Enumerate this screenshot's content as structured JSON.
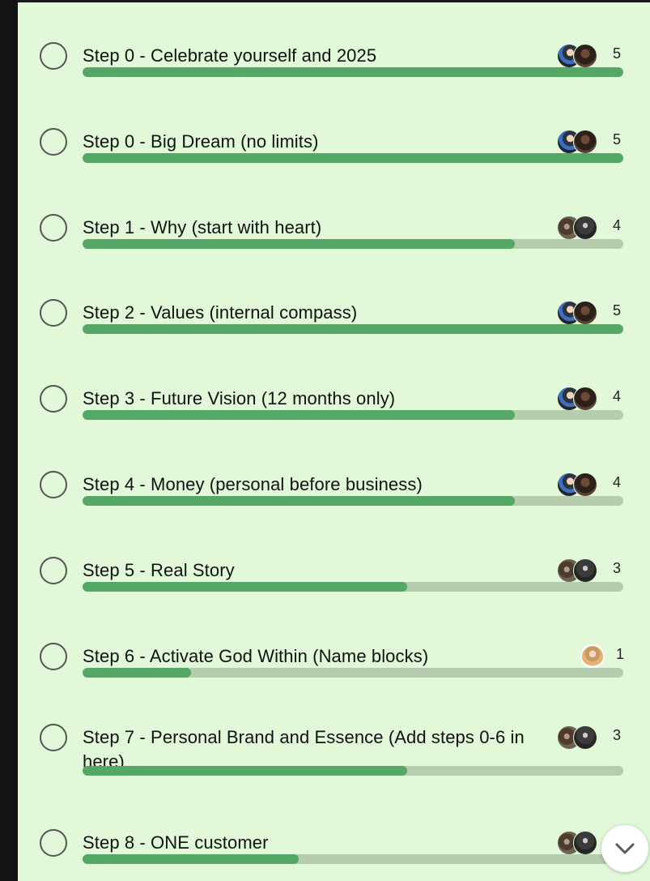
{
  "poll": {
    "options": [
      {
        "label": "Step 0 - Celebrate yourself and 2025",
        "votes": "5",
        "fraction": 1.0,
        "voter_avatars": [
          "avatar-suit-man",
          "avatar-dark-portrait"
        ]
      },
      {
        "label": "Step 0 - Big Dream (no limits)",
        "votes": "5",
        "fraction": 1.0,
        "voter_avatars": [
          "avatar-suit-man",
          "avatar-dark-portrait"
        ]
      },
      {
        "label": "Step 1 - Why (start with heart)",
        "votes": "4",
        "fraction": 0.8,
        "voter_avatars": [
          "avatar-landscape",
          "avatar-statue"
        ]
      },
      {
        "label": "Step 2 - Values (internal compass)",
        "votes": "5",
        "fraction": 1.0,
        "voter_avatars": [
          "avatar-suit-man",
          "avatar-dark-portrait"
        ]
      },
      {
        "label": "Step 3 - Future Vision (12 months only)",
        "votes": "4",
        "fraction": 0.8,
        "voter_avatars": [
          "avatar-suit-man",
          "avatar-dark-portrait"
        ]
      },
      {
        "label": "Step 4 - Money (personal before business)",
        "votes": "4",
        "fraction": 0.8,
        "voter_avatars": [
          "avatar-suit-man",
          "avatar-dark-portrait"
        ]
      },
      {
        "label": "Step 5 - Real Story",
        "votes": "3",
        "fraction": 0.6,
        "voter_avatars": [
          "avatar-landscape",
          "avatar-statue"
        ]
      },
      {
        "label": "Step 6 - Activate God Within (Name blocks)",
        "votes": "1",
        "fraction": 0.2,
        "voter_avatars": [
          "avatar-blonde-woman"
        ]
      },
      {
        "label": "Step 7 - Personal Brand and Essence (Add steps 0-6 in here)",
        "votes": "3",
        "fraction": 0.6,
        "voter_avatars": [
          "avatar-landscape",
          "avatar-statue"
        ]
      },
      {
        "label": "Step 8 - ONE customer",
        "votes": "",
        "fraction": 0.4,
        "voter_avatars": [
          "avatar-landscape",
          "avatar-statue"
        ]
      }
    ]
  },
  "colors": {
    "background": "#e1f9d8",
    "progress_fill": "#55a765",
    "progress_track": "#b6ccae",
    "radio_border": "#545454"
  },
  "scroll_button": {
    "icon": "chevron-down-icon"
  }
}
